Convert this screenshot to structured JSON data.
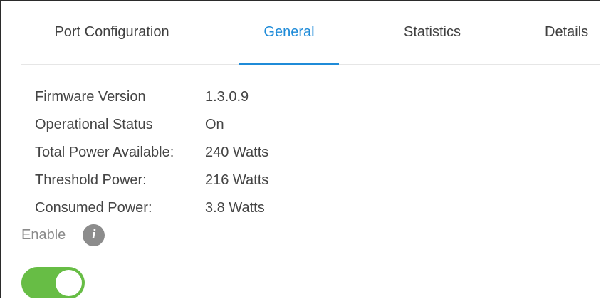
{
  "tabs": [
    {
      "label": "Port Configuration",
      "active": false
    },
    {
      "label": "General",
      "active": true
    },
    {
      "label": "Statistics",
      "active": false
    },
    {
      "label": "Details",
      "active": false
    }
  ],
  "properties": [
    {
      "label": "Firmware Version",
      "value": "1.3.0.9"
    },
    {
      "label": "Operational Status",
      "value": "On"
    },
    {
      "label": "Total Power Available:",
      "value": "240 Watts"
    },
    {
      "label": "Threshold Power:",
      "value": "216 Watts"
    },
    {
      "label": "Consumed Power:",
      "value": "3.8 Watts"
    }
  ],
  "enable": {
    "label": "Enable",
    "info_icon": "info-icon",
    "toggle_on": true
  },
  "colors": {
    "accent": "#1f8bd8",
    "toggle_on": "#67bd45",
    "info_icon_bg": "#8c8c8c"
  }
}
